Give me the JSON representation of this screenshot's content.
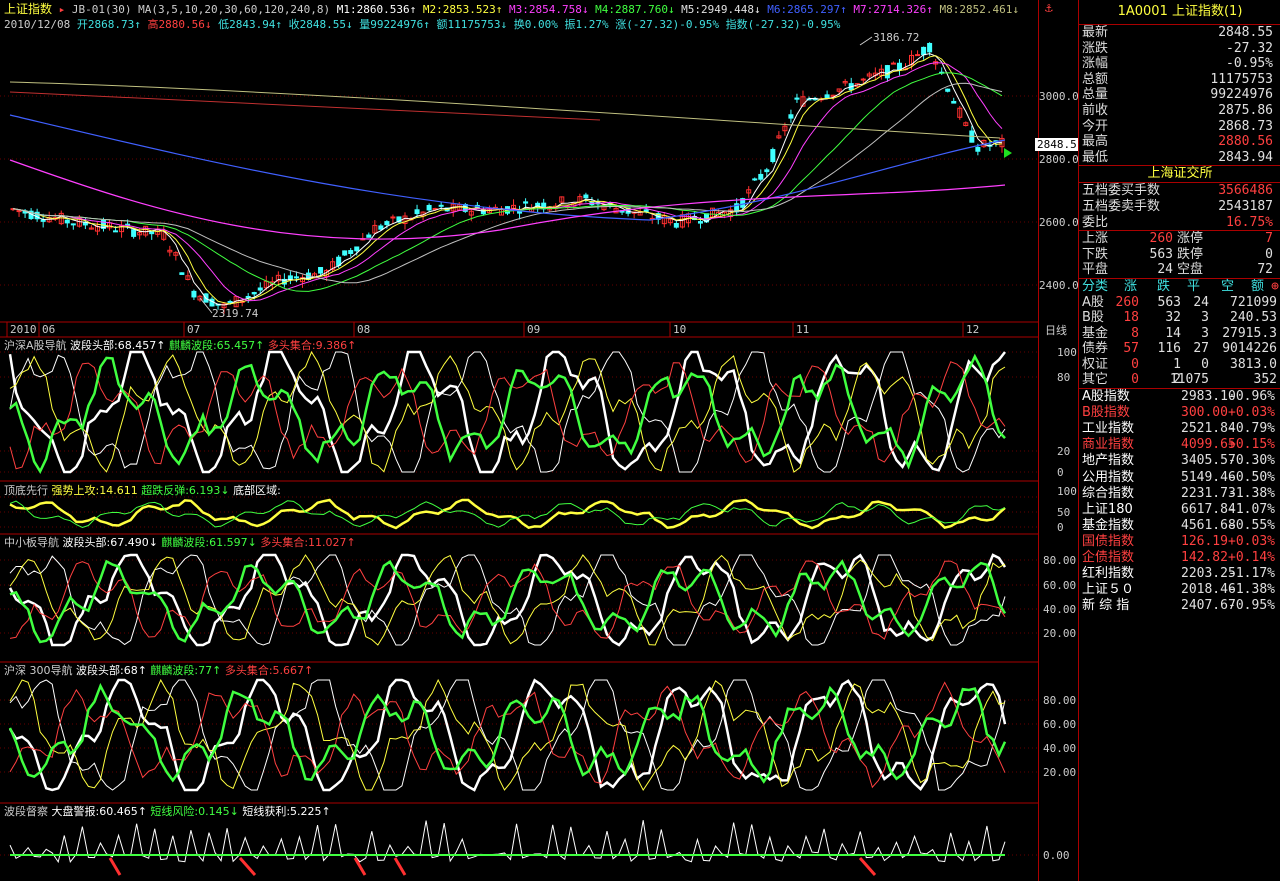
{
  "title_bar": {
    "name": "上证指数",
    "info": "JB-01(30) MA(3,5,10,20,30,60,120,240,8)",
    "ma": [
      {
        "t": "M1:2860.536↑",
        "c": "#ffffff"
      },
      {
        "t": "M2:2853.523↑",
        "c": "#ffff40"
      },
      {
        "t": "M3:2854.758↓",
        "c": "#ff40ff"
      },
      {
        "t": "M4:2887.760↓",
        "c": "#40ff40"
      },
      {
        "t": "M5:2949.448↓",
        "c": "#e0e0e0"
      },
      {
        "t": "M6:2865.297↑",
        "c": "#4060ff"
      },
      {
        "t": "M7:2714.326↑",
        "c": "#ff40ff"
      },
      {
        "t": "M8:2852.461↓",
        "c": "#c0c080"
      }
    ],
    "date_line": [
      {
        "t": "2010/12/08",
        "c": "#cccccc"
      },
      {
        "t": "开2868.73↑",
        "c": "#40e0e0"
      },
      {
        "t": "高2880.56↓",
        "c": "#ff4040"
      },
      {
        "t": "低2843.94↑",
        "c": "#40e0e0"
      },
      {
        "t": "收2848.55↓",
        "c": "#40e0e0"
      },
      {
        "t": "量99224976↑",
        "c": "#40e0e0"
      },
      {
        "t": "额11175753↓",
        "c": "#40e0e0"
      },
      {
        "t": "换0.00%",
        "c": "#40e0e0"
      },
      {
        "t": "振1.27%",
        "c": "#40e0e0"
      },
      {
        "t": "涨(-27.32)-0.95%",
        "c": "#40e0e0"
      },
      {
        "t": "指数(-27.32)-0.95%",
        "c": "#40e0e0"
      }
    ]
  },
  "price_axis": [
    "3000.0",
    "2800.0",
    "2600.0",
    "2400.0"
  ],
  "price_current": "2848.5",
  "annotations": {
    "high": "3186.72",
    "low": "2319.74"
  },
  "month_labels": [
    "2010",
    "06",
    "07",
    "08",
    "09",
    "10",
    "11",
    "12"
  ],
  "period_label": "日线",
  "indicators": [
    {
      "name": "沪深A股导航",
      "items": [
        {
          "t": "波段头部:68.457↑",
          "c": "#ffffff"
        },
        {
          "t": "麒麟波段:65.457↑",
          "c": "#40ff40"
        },
        {
          "t": "多头集合:9.386↑",
          "c": "#ff4040"
        }
      ],
      "axis": [
        "100",
        "80",
        "20",
        "0"
      ]
    },
    {
      "name": "顶底先行",
      "items": [
        {
          "t": "强势上攻:14.611",
          "c": "#ffff40"
        },
        {
          "t": "超跌反弹:6.193↓",
          "c": "#40ff40"
        },
        {
          "t": "底部区域:",
          "c": "#ffffff"
        }
      ],
      "axis": [
        "100",
        "50",
        "0"
      ]
    },
    {
      "name": "中小板导航",
      "items": [
        {
          "t": "波段头部:67.490↓",
          "c": "#ffffff"
        },
        {
          "t": "麒麟波段:61.597↓",
          "c": "#40ff40"
        },
        {
          "t": "多头集合:11.027↑",
          "c": "#ff4040"
        }
      ],
      "axis": [
        "80.00",
        "60.00",
        "40.00",
        "20.00"
      ]
    },
    {
      "name": "沪深 300导航",
      "items": [
        {
          "t": "波段头部:68↑",
          "c": "#ffffff"
        },
        {
          "t": "麒麟波段:77↑",
          "c": "#40ff40"
        },
        {
          "t": "多头集合:5.667↑",
          "c": "#ff4040"
        }
      ],
      "axis": [
        "80.00",
        "60.00",
        "40.00",
        "20.00"
      ]
    },
    {
      "name": "波段督察",
      "items": [
        {
          "t": "大盘警报:60.465↑",
          "c": "#ffffff"
        },
        {
          "t": "短线风险:0.145↓",
          "c": "#40ff40"
        },
        {
          "t": "短线获利:5.225↑",
          "c": "#ffffff"
        }
      ],
      "axis": [
        "0.00"
      ]
    }
  ],
  "panel": {
    "header": "1A0001 上证指数(1)",
    "quote": [
      {
        "k": "最新",
        "v": "2848.55",
        "c": "#e0e0e0"
      },
      {
        "k": "涨跌",
        "v": "-27.32",
        "c": "#e0e0e0"
      },
      {
        "k": "涨幅",
        "v": "-0.95%",
        "c": "#e0e0e0"
      },
      {
        "k": "总额",
        "v": "11175753",
        "c": "#e0e0e0"
      },
      {
        "k": "总量",
        "v": "99224976",
        "c": "#e0e0e0"
      },
      {
        "k": "前收",
        "v": "2875.86",
        "c": "#e0e0e0"
      },
      {
        "k": "今开",
        "v": "2868.73",
        "c": "#e0e0e0"
      },
      {
        "k": "最高",
        "v": "2880.56",
        "c": "#ff4040"
      },
      {
        "k": "最低",
        "v": "2843.94",
        "c": "#e0e0e0"
      }
    ],
    "exchange": "上海证交所",
    "orders": [
      {
        "k": "五档委买手数",
        "v": "3566486",
        "c": "#ff4040"
      },
      {
        "k": "五档委卖手数",
        "v": "2543187",
        "c": "#e0e0e0"
      },
      {
        "k": "委比",
        "v": "16.75%",
        "c": "#ff4040"
      }
    ],
    "breadth": [
      {
        "k1": "上涨",
        "v1": "260",
        "c1": "#ff4040",
        "k2": "涨停",
        "v2": "7",
        "c2": "#ff4040"
      },
      {
        "k1": "下跌",
        "v1": "563",
        "c1": "#e0e0e0",
        "k2": "跌停",
        "v2": "0",
        "c2": "#e0e0e0"
      },
      {
        "k1": "平盘",
        "v1": "24",
        "c1": "#e0e0e0",
        "k2": "空盘",
        "v2": "72",
        "c2": "#e0e0e0"
      }
    ],
    "table_headers": [
      "分类",
      "涨",
      "跌",
      "平",
      "空",
      "额"
    ],
    "table_rows": [
      {
        "k": "A股",
        "a": "260",
        "b": "563",
        "c": "24",
        "d": "721099"
      },
      {
        "k": "B股",
        "a": "18",
        "b": "32",
        "c": "3",
        "d": "240.53"
      },
      {
        "k": "基金",
        "a": "8",
        "b": "14",
        "c": "3",
        "d": "27915.3"
      },
      {
        "k": "债券",
        "a": "57",
        "b": "116",
        "c": "27",
        "d": "9014226"
      },
      {
        "k": "权证",
        "a": "0",
        "b": "1",
        "c": "0",
        "d": "3813.0"
      },
      {
        "k": "其它",
        "a": "0",
        "b": "2",
        "c": "11075",
        "d": "352"
      }
    ],
    "indices": [
      {
        "n": "A股指数",
        "p": "2983.10",
        "c": "-0.96%",
        "col": "#e0e0e0"
      },
      {
        "n": "B股指数",
        "p": "300.00",
        "c": "+0.03%",
        "col": "#ff4040"
      },
      {
        "n": "工业指数",
        "p": "2521.84",
        "c": "-0.79%",
        "col": "#e0e0e0"
      },
      {
        "n": "商业指数",
        "p": "4099.65",
        "c": "+0.15%",
        "col": "#ff4040"
      },
      {
        "n": "地产指数",
        "p": "3405.57",
        "c": "-0.30%",
        "col": "#e0e0e0"
      },
      {
        "n": "公用指数",
        "p": "5149.46",
        "c": "-0.50%",
        "col": "#e0e0e0"
      },
      {
        "n": "综合指数",
        "p": "2231.73",
        "c": "-1.38%",
        "col": "#e0e0e0"
      },
      {
        "n": "上证180",
        "p": "6617.84",
        "c": "-1.07%",
        "col": "#e0e0e0"
      },
      {
        "n": "基金指数",
        "p": "4561.68",
        "c": "-0.55%",
        "col": "#e0e0e0"
      },
      {
        "n": "国债指数",
        "p": "126.19",
        "c": "+0.03%",
        "col": "#ff4040"
      },
      {
        "n": "企债指数",
        "p": "142.82",
        "c": "+0.14%",
        "col": "#ff4040"
      },
      {
        "n": "红利指数",
        "p": "2203.25",
        "c": "-1.17%",
        "col": "#e0e0e0"
      },
      {
        "n": "上证５０",
        "p": "2018.46",
        "c": "-1.38%",
        "col": "#e0e0e0"
      },
      {
        "n": "新 综 指",
        "p": "2407.67",
        "c": "-0.95%",
        "col": "#e0e0e0"
      }
    ]
  }
}
